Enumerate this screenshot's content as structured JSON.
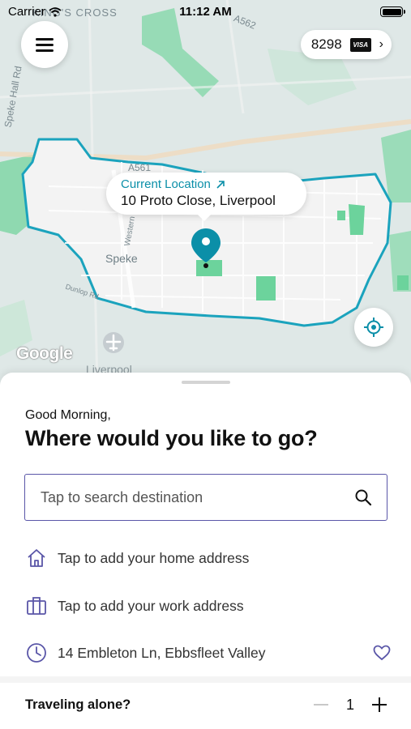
{
  "status_bar": {
    "carrier": "Carrier",
    "time": "11:12 AM"
  },
  "map": {
    "labels": {
      "kings_cross": "KING'S CROSS",
      "a562": "A562",
      "speke_hall_rd": "Speke Hall Rd",
      "a561": "A561",
      "speke": "Speke",
      "western": "Western",
      "dunlop": "Dunlop Rd",
      "liverpool": "Liverpool"
    },
    "google_logo": "Google",
    "callout": {
      "label": "Current Location",
      "address": "10 Proto Close, Liverpool"
    },
    "colors": {
      "accent": "#0b8fa8",
      "zone_border": "#1ba3bd",
      "park": "#6cd39c"
    }
  },
  "payment": {
    "card_last4": "8298",
    "brand": "VISA"
  },
  "sheet": {
    "greeting": "Good Morning,",
    "headline": "Where would you like to go?",
    "search": {
      "placeholder": "Tap to search destination",
      "value": ""
    },
    "quick_links": [
      {
        "label": "Tap to add your home address",
        "icon": "home-icon"
      },
      {
        "label": "Tap to add your work address",
        "icon": "briefcase-icon"
      },
      {
        "label": "14 Embleton Ln, Ebbsfleet Valley",
        "icon": "clock-icon",
        "favorite_icon": "heart-icon"
      }
    ],
    "travel": {
      "question": "Traveling alone?",
      "count": "1"
    },
    "accent_color": "#5a56a8"
  }
}
